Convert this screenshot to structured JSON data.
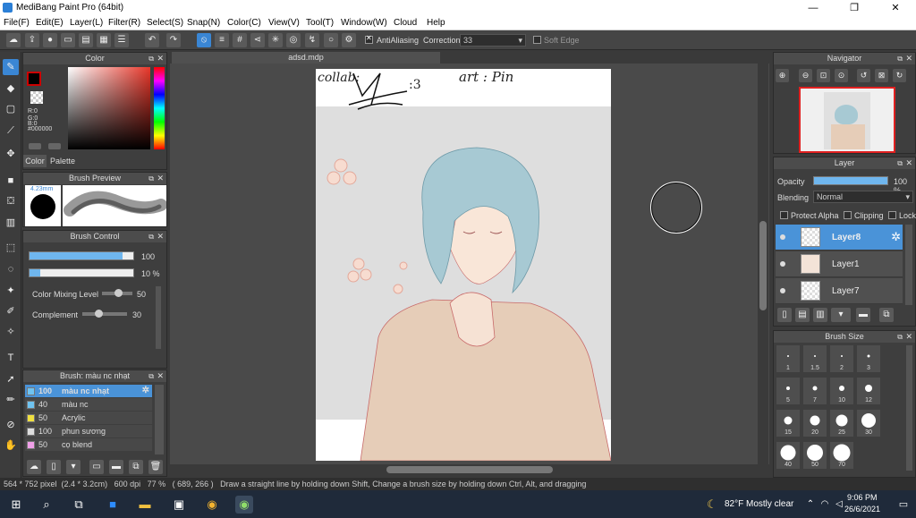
{
  "window": {
    "title": "MediBang Paint Pro (64bit)",
    "controls": {
      "minimize": "—",
      "maximize": "❐",
      "close": "✕"
    }
  },
  "menu": [
    "File(F)",
    "Edit(E)",
    "Layer(L)",
    "Filter(R)",
    "Select(S)",
    "Snap(N)",
    "Color(C)",
    "View(V)",
    "Tool(T)",
    "Window(W)",
    "Cloud",
    "Help"
  ],
  "toolbar": {
    "antialiasing_label": "AntiAliasing",
    "correction_label": "Correction",
    "correction_value": "33",
    "soft_edge_label": "Soft Edge",
    "antialiasing_checked": true,
    "soft_edge_checked": false
  },
  "color_panel": {
    "title": "Color",
    "rgb": {
      "r": "R:0",
      "g": "G:0",
      "b": "B:0"
    },
    "hex": "#000000",
    "tabs": [
      "Color",
      "Palette"
    ],
    "primary_color": "#000000",
    "hue_accent": "#e8372a"
  },
  "brush_preview": {
    "title": "Brush Preview",
    "size_label": "4.23mm"
  },
  "brush_control": {
    "title": "Brush Control",
    "size_value": "100",
    "size_fraction": 0.9,
    "opacity_value": "10 %",
    "opacity_fraction": 0.1,
    "color_mixing_label": "Color Mixing Level",
    "color_mixing_value": "50",
    "complement_label": "Complement",
    "complement_value": "30"
  },
  "brush_list": {
    "title": "Brush: màu nc nhạt",
    "items": [
      {
        "size": "100",
        "name": "màu nc nhạt",
        "color": "#6fc3f0",
        "selected": true
      },
      {
        "size": "40",
        "name": "màu nc",
        "color": "#6fc3f0",
        "selected": false
      },
      {
        "size": "50",
        "name": "Acrylic",
        "color": "#f0e040",
        "selected": false
      },
      {
        "size": "100",
        "name": "phun sương",
        "color": "#dddddd",
        "selected": false
      },
      {
        "size": "50",
        "name": "cọ blend",
        "color": "#f0a0e8",
        "selected": false
      }
    ]
  },
  "document": {
    "tab_title": "adsd.mdp",
    "text_signature": "collab:",
    "text_face": ":3",
    "text_art": "art : Pin"
  },
  "navigator": {
    "title": "Navigator"
  },
  "layer_panel": {
    "title": "Layer",
    "opacity_label": "Opacity",
    "opacity_value": "100 %",
    "opacity_fraction": 1.0,
    "blending_label": "Blending",
    "blending_value": "Normal",
    "protect_alpha_label": "Protect Alpha",
    "clipping_label": "Clipping",
    "lock_label": "Lock",
    "layers": [
      {
        "name": "Layer8",
        "selected": true
      },
      {
        "name": "Layer1",
        "selected": false
      },
      {
        "name": "Layer7",
        "selected": false
      }
    ]
  },
  "brush_size_panel": {
    "title": "Brush Size",
    "sizes": [
      "1",
      "1.5",
      "2",
      "3",
      "5",
      "7",
      "10",
      "12",
      "15",
      "20",
      "25",
      "30",
      "40",
      "50",
      "70"
    ]
  },
  "status": {
    "text": "564 * 752 pixel  (2.4 * 3.2cm)   600 dpi   77 %   ( 689, 266 )   Draw a straight line by holding down Shift, Change a brush size by holding down Ctrl, Alt, and dragging"
  },
  "taskbar": {
    "weather": "82°F  Mostly clear",
    "time": "9:06 PM",
    "date": "26/6/2021"
  }
}
